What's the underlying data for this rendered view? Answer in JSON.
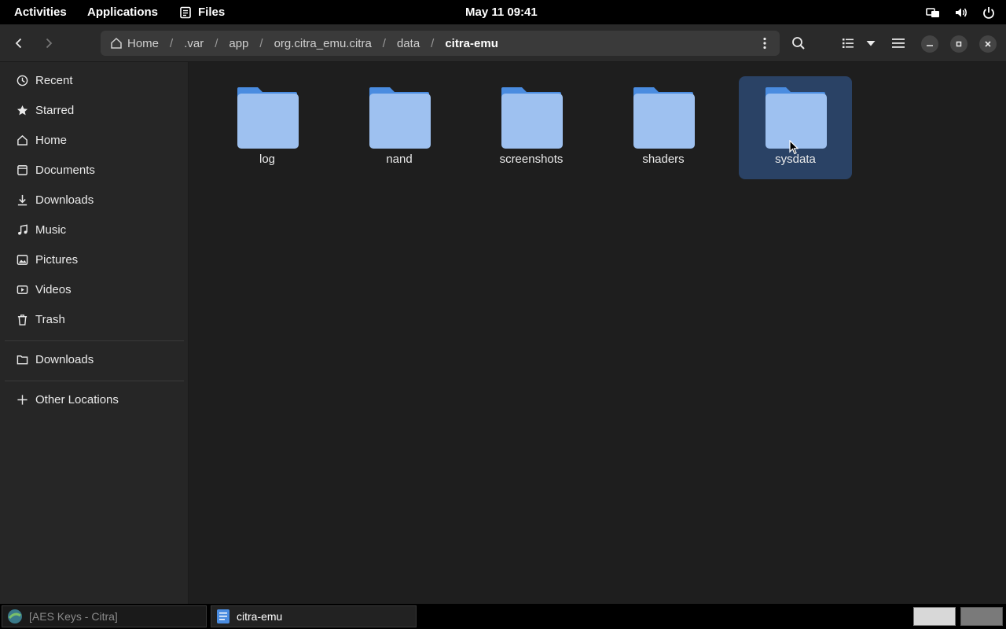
{
  "topbar": {
    "activities": "Activities",
    "applications": "Applications",
    "app_name": "Files",
    "clock": "May 11  09:41"
  },
  "pathbar": {
    "crumbs": [
      "Home",
      ".var",
      "app",
      "org.citra_emu.citra",
      "data"
    ],
    "current": "citra-emu"
  },
  "sidebar": {
    "items": [
      {
        "label": "Recent",
        "icon": "clock-icon"
      },
      {
        "label": "Starred",
        "icon": "star-icon"
      },
      {
        "label": "Home",
        "icon": "home-icon"
      },
      {
        "label": "Documents",
        "icon": "document-icon"
      },
      {
        "label": "Downloads",
        "icon": "download-icon"
      },
      {
        "label": "Music",
        "icon": "music-icon"
      },
      {
        "label": "Pictures",
        "icon": "picture-icon"
      },
      {
        "label": "Videos",
        "icon": "video-icon"
      },
      {
        "label": "Trash",
        "icon": "trash-icon"
      }
    ],
    "bookmarks": [
      {
        "label": "Downloads",
        "icon": "folder-icon"
      }
    ],
    "other": {
      "label": "Other Locations",
      "icon": "plus-icon"
    }
  },
  "files": [
    {
      "name": "log",
      "selected": false
    },
    {
      "name": "nand",
      "selected": false
    },
    {
      "name": "screenshots",
      "selected": false
    },
    {
      "name": "shaders",
      "selected": false
    },
    {
      "name": "sysdata",
      "selected": true
    }
  ],
  "taskbar": {
    "tasks": [
      {
        "label": "[AES Keys - Citra]",
        "active": false
      },
      {
        "label": "citra-emu",
        "active": true
      }
    ]
  },
  "colors": {
    "folder_body": "#9ec1f0",
    "folder_back": "#4a8ce0",
    "selection": "#2a4265",
    "sidebar_bg": "#262626",
    "content_bg": "#1e1e1e"
  }
}
